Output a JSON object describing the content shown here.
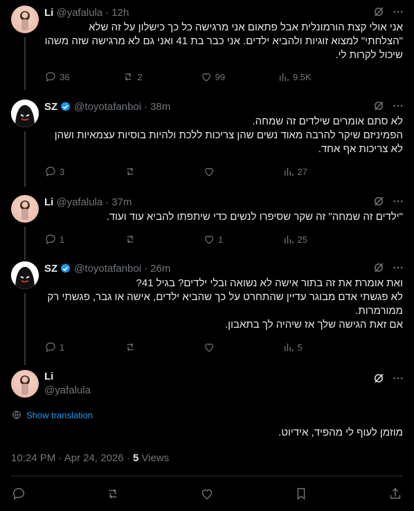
{
  "replies": [
    {
      "name": "Li",
      "handle": "@yafalula",
      "time": "12h",
      "text": "אני אולי קצת הורמונלית אבל פתאום אני מרגישה כל כך כישלון על זה שלא \"הצלחתי\" למצוא זוגיות ולהביא ילדים. אני כבר בת 41 ואני גם לא מרגישה שזה משהו שיכול לקרות לי.",
      "replies": "36",
      "reposts": "2",
      "likes": "99",
      "views": "9.5K"
    },
    {
      "name": "SZ",
      "handle": "@toyotafanboi",
      "time": "38m",
      "text": "לא סתם אומרים שילדים זה שמחה.\nהפמיניזם שיקר להרבה מאוד נשים שהן צריכות ללכת ולהיות בוסיות עצמאיות ושהן לא צריכות אף אחד.",
      "replies": "3",
      "reposts": "",
      "likes": "",
      "views": "27"
    },
    {
      "name": "Li",
      "handle": "@yafalula",
      "time": "37m",
      "text": "\"ילדים זה שמחה\" זה שקר שסיפרו לנשים כדי שיתפתו להביא עוד ועוד.",
      "replies": "1",
      "reposts": "",
      "likes": "1",
      "views": "25"
    },
    {
      "name": "SZ",
      "handle": "@toyotafanboi",
      "time": "26m",
      "text": "ואת אומרת את זה בתור אישה לא נשואה ובלי ילדים? בגיל 41?\nלא פגשתי אדם מבוגר עדיין שהתחרט על כך שהביא ילדים, אישה או גבר, פגשתי רק ממורמרות.\nאם זאת הגישה שלך אז שיהיה לך בתאבון.",
      "replies": "1",
      "reposts": "",
      "likes": "",
      "views": "5"
    }
  ],
  "main_post": {
    "name": "Li",
    "handle": "@yafalula",
    "show_translation": "Show translation",
    "text": "מוזמן לעוף לי מהפיד, אידיוט.",
    "timestamp": "10:24 PM · Apr 24, 2026 · ",
    "views_count": "5",
    "views_label": " Views"
  },
  "colors": {
    "background": "#000000",
    "text": "#e7e9ea",
    "muted": "#71767b",
    "accent": "#1d9bf0"
  }
}
